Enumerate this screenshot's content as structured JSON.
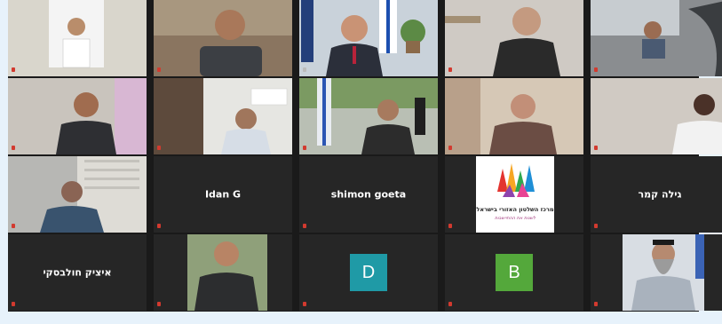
{
  "participants": [
    {
      "label": "",
      "muted": true
    },
    {
      "label": "",
      "muted": true
    },
    {
      "label": "",
      "muted": false,
      "active": true
    },
    {
      "label": "",
      "muted": true
    },
    {
      "label": "",
      "muted": true
    },
    {
      "label": "",
      "muted": true
    },
    {
      "label": "",
      "muted": true
    },
    {
      "label": "",
      "muted": true
    },
    {
      "label": "",
      "muted": true
    },
    {
      "label": "",
      "muted": true
    },
    {
      "label": "",
      "muted": true
    },
    {
      "name": "Idan G",
      "label": "",
      "muted": true
    },
    {
      "name": "shimon goeta",
      "label": "",
      "muted": true
    },
    {
      "label": "",
      "muted": true
    },
    {
      "name": "גילה קמר",
      "label": "",
      "muted": true
    },
    {
      "name": "איציק חולבסקי",
      "label": "",
      "muted": true
    },
    {
      "label": "",
      "muted": true
    },
    {
      "avatar": "D",
      "avatar_color": "#1f9aa6",
      "label": "",
      "muted": true
    },
    {
      "avatar": "B",
      "avatar_color": "#54a83b",
      "label": "",
      "muted": true
    },
    {
      "label": "",
      "muted": true
    }
  ],
  "logo": {
    "title": "מרכז השלטון האזורי בישראל",
    "tagline": "לשנות את ההתיישבות"
  },
  "colors": {
    "active_speaker": "#3fbf3f",
    "muted_mic": "#d23a2f",
    "page_bg": "#e7f2fb"
  }
}
